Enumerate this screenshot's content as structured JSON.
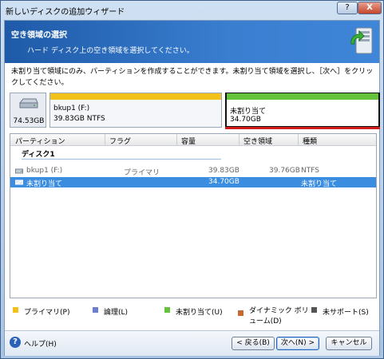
{
  "window": {
    "title": "新しいディスクの追加ウィザード",
    "help_button": "?",
    "close_button": "X"
  },
  "banner": {
    "title": "空き領域の選択",
    "subtitle": "ハード ディスク上の空き領域を選択してください。"
  },
  "description": "未割り当て領域にのみ、パーティションを作成することができます。未割り当て領域を選択し、［次へ］をクリックしてください。",
  "disk_strip": {
    "disk_size": "74.53GB",
    "partitions": [
      {
        "name": "bkup1 (F:)",
        "info": "39.83GB  NTFS",
        "color": "#f3c21a"
      },
      {
        "name": "未割り当て",
        "info": "34.70GB",
        "color": "#64c23b"
      }
    ]
  },
  "table": {
    "columns": [
      "パーティション",
      "フラグ",
      "容量",
      "空き領域",
      "種類"
    ],
    "group": "ディスク1",
    "rows": [
      {
        "partition": "bkup1 (F:)",
        "flag": "プライマリ",
        "capacity": "39.83GB",
        "free": "39.76GB",
        "type": "NTFS"
      },
      {
        "partition": "未割り当て",
        "flag": "",
        "capacity": "34.70GB",
        "free": "",
        "type": "未割り当て"
      }
    ]
  },
  "legend": [
    {
      "label": "プライマリ(P)",
      "color": "#f3c21a"
    },
    {
      "label": "論理(L)",
      "color": "#6a7fd0"
    },
    {
      "label": "未割り当て(U)",
      "color": "#64c23b"
    },
    {
      "label": "ダイナミック ボリューム(D)",
      "color": "#c86a2e"
    },
    {
      "label": "未サポート(S)",
      "color": "#555555"
    }
  ],
  "footer": {
    "help": "ヘルプ(H)",
    "back": "< 戻る(B)",
    "next": "次へ(N) >",
    "cancel": "キャンセル"
  }
}
